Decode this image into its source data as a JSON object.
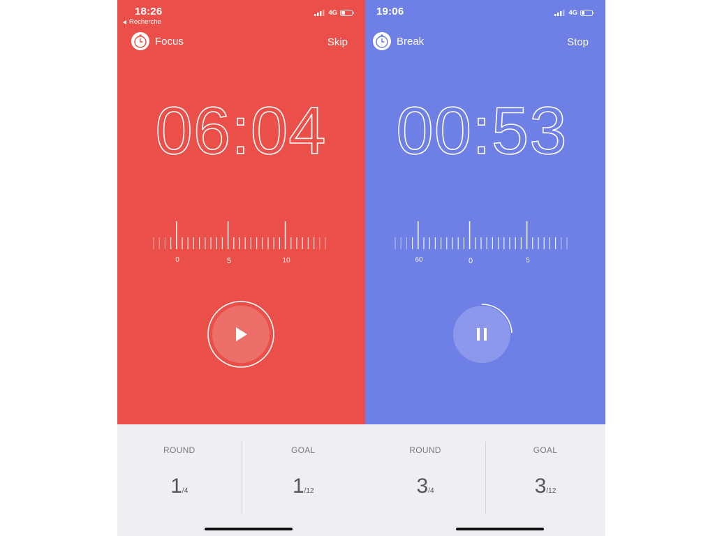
{
  "screens": [
    {
      "status": {
        "time": "18:26",
        "back_link": "Recherche",
        "network": "4G",
        "battery_level": 0.35
      },
      "mode_label": "Focus",
      "action_label": "Skip",
      "timer": "06:04",
      "ruler_labels": [
        "0",
        "5",
        "10"
      ],
      "control": "play-icon",
      "round": {
        "label": "ROUND",
        "value": "1",
        "total": "/4"
      },
      "goal": {
        "label": "GOAL",
        "value": "1",
        "total": "/12"
      },
      "accent_color": "#ea5049"
    },
    {
      "status": {
        "time": "19:06",
        "back_link": "",
        "network": "4G",
        "battery_level": 0.25
      },
      "mode_label": "Break",
      "action_label": "Stop",
      "timer": "00:53",
      "ruler_labels": [
        "60",
        "0",
        "5"
      ],
      "control": "pause-icon",
      "round": {
        "label": "ROUND",
        "value": "3",
        "total": "/4"
      },
      "goal": {
        "label": "GOAL",
        "value": "3",
        "total": "/12"
      },
      "accent_color": "#6e7fe6"
    }
  ]
}
